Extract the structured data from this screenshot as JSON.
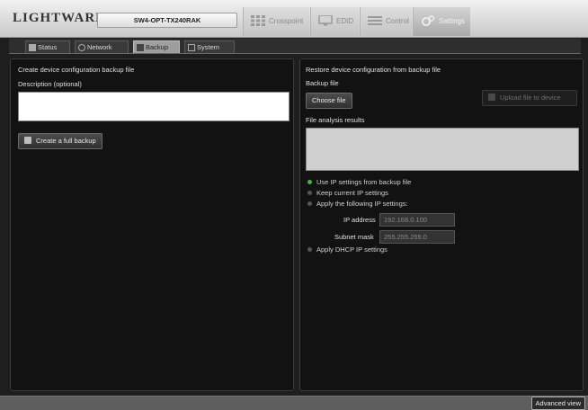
{
  "header": {
    "logo": "LIGHTWARE",
    "device_name": "SW4-OPT-TX240RAK",
    "tabs": [
      {
        "label": "Crosspoint",
        "icon": "crosspoint-icon"
      },
      {
        "label": "EDID",
        "icon": "monitor-icon"
      },
      {
        "label": "Control",
        "icon": "control-icon"
      },
      {
        "label": "Settings",
        "icon": "gear-icon"
      }
    ],
    "active_tab": "Settings"
  },
  "subtabs": [
    {
      "label": "Status",
      "icon": "status-icon"
    },
    {
      "label": "Network",
      "icon": "network-icon"
    },
    {
      "label": "Backup",
      "icon": "backup-icon"
    },
    {
      "label": "System",
      "icon": "system-icon"
    }
  ],
  "active_subtab": "Backup",
  "backup": {
    "title": "Create device configuration backup file",
    "description_label": "Description (optional)",
    "description_value": "",
    "create_button": "Create a full backup"
  },
  "restore": {
    "title": "Restore device configuration from backup file",
    "backup_file_label": "Backup file",
    "choose_button": "Choose file",
    "upload_button": "Upload file to device",
    "analysis_label": "File analysis results",
    "options": [
      {
        "label": "Use IP settings from backup file",
        "checked": true
      },
      {
        "label": "Keep current IP settings",
        "checked": false
      },
      {
        "label": "Apply the following IP settings:",
        "checked": false
      },
      {
        "label": "Apply DHCP IP settings",
        "checked": false
      }
    ],
    "ip_label": "IP address",
    "ip_value": "192.168.0.100",
    "mask_label": "Subnet mask",
    "mask_value": "255.255.255.0"
  },
  "footer": {
    "advanced_button": "Advanced view"
  },
  "colors": {
    "background": "#1e1e1e",
    "panel": "#121212",
    "radio_checked": "#4caf50",
    "header_gradient_top": "#f2f2f2"
  }
}
